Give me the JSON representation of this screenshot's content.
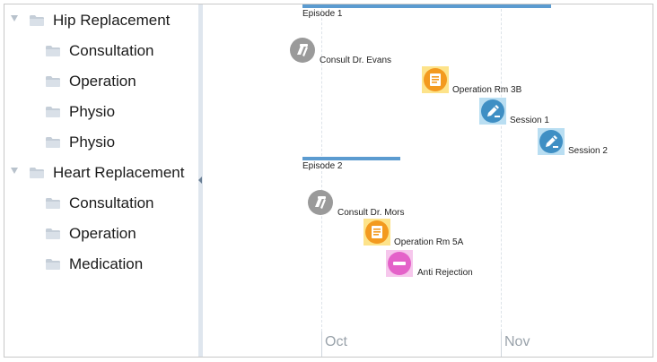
{
  "tree": {
    "groups": [
      {
        "label": "Hip Replacement",
        "children": [
          "Consultation",
          "Operation",
          "Physio",
          "Physio"
        ]
      },
      {
        "label": "Heart Replacement",
        "children": [
          "Consultation",
          "Operation",
          "Medication"
        ]
      }
    ]
  },
  "timeline": {
    "axis": [
      "Oct",
      "Nov"
    ],
    "episodes": [
      {
        "label": "Episode 1",
        "events": [
          "Consult Dr. Evans",
          "Operation Rm 3B",
          "Session 1",
          "Session 2"
        ]
      },
      {
        "label": "Episode 2",
        "events": [
          "Consult Dr. Mors",
          "Operation Rm 5A",
          "Anti Rejection"
        ]
      }
    ],
    "icons": {
      "consult": "stethoscope-icon",
      "operation": "clipboard-icon",
      "session": "pencil-icon",
      "medication": "minus-icon"
    },
    "colors": {
      "consult": "#9a9a9a",
      "operation": "#f39a1f",
      "operation_bg": "#fde38a",
      "session": "#3f8fc4",
      "session_bg": "#b9def2",
      "medication": "#e462c9",
      "medication_bg": "#f6c7ec",
      "episode_bar": "#5b9bd0"
    }
  }
}
